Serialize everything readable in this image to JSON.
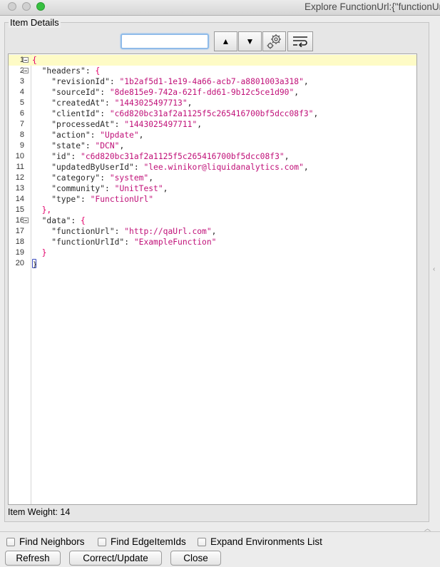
{
  "window": {
    "title": "Explore FunctionUrl:{\"functionUrl"
  },
  "panel": {
    "legend": "Item Details"
  },
  "search": {
    "value": "",
    "placeholder": ""
  },
  "toolbar": {
    "up_icon": "up-arrow-icon",
    "down_icon": "down-arrow-icon",
    "settings_icon": "gear-icon",
    "wrap_icon": "word-wrap-icon"
  },
  "editor": {
    "current_line": 1,
    "lines": [
      {
        "n": "1",
        "fold": true,
        "tokens": [
          {
            "t": "{",
            "c": "brace"
          }
        ]
      },
      {
        "n": "2",
        "fold": true,
        "tokens": [
          {
            "t": "  \"headers\"",
            "c": "key"
          },
          {
            "t": ": ",
            "c": "plain"
          },
          {
            "t": "{",
            "c": "brace"
          }
        ]
      },
      {
        "n": "3",
        "fold": false,
        "tokens": [
          {
            "t": "    \"revisionId\"",
            "c": "key"
          },
          {
            "t": ": ",
            "c": "plain"
          },
          {
            "t": "\"1b2af5d1-1e19-4a66-acb7-a8801003a318\"",
            "c": "str"
          },
          {
            "t": ",",
            "c": "plain"
          }
        ]
      },
      {
        "n": "4",
        "fold": false,
        "tokens": [
          {
            "t": "    \"sourceId\"",
            "c": "key"
          },
          {
            "t": ": ",
            "c": "plain"
          },
          {
            "t": "\"8de815e9-742a-621f-dd61-9b12c5ce1d90\"",
            "c": "str"
          },
          {
            "t": ",",
            "c": "plain"
          }
        ]
      },
      {
        "n": "5",
        "fold": false,
        "tokens": [
          {
            "t": "    \"createdAt\"",
            "c": "key"
          },
          {
            "t": ": ",
            "c": "plain"
          },
          {
            "t": "\"1443025497713\"",
            "c": "str"
          },
          {
            "t": ",",
            "c": "plain"
          }
        ]
      },
      {
        "n": "6",
        "fold": false,
        "tokens": [
          {
            "t": "    \"clientId\"",
            "c": "key"
          },
          {
            "t": ": ",
            "c": "plain"
          },
          {
            "t": "\"c6d820bc31af2a1125f5c265416700bf5dcc08f3\"",
            "c": "str"
          },
          {
            "t": ",",
            "c": "plain"
          }
        ]
      },
      {
        "n": "7",
        "fold": false,
        "tokens": [
          {
            "t": "    \"processedAt\"",
            "c": "key"
          },
          {
            "t": ": ",
            "c": "plain"
          },
          {
            "t": "\"1443025497711\"",
            "c": "str"
          },
          {
            "t": ",",
            "c": "plain"
          }
        ]
      },
      {
        "n": "8",
        "fold": false,
        "tokens": [
          {
            "t": "    \"action\"",
            "c": "key"
          },
          {
            "t": ": ",
            "c": "plain"
          },
          {
            "t": "\"Update\"",
            "c": "str"
          },
          {
            "t": ",",
            "c": "plain"
          }
        ]
      },
      {
        "n": "9",
        "fold": false,
        "tokens": [
          {
            "t": "    \"state\"",
            "c": "key"
          },
          {
            "t": ": ",
            "c": "plain"
          },
          {
            "t": "\"DCN\"",
            "c": "str"
          },
          {
            "t": ",",
            "c": "plain"
          }
        ]
      },
      {
        "n": "10",
        "fold": false,
        "tokens": [
          {
            "t": "    \"id\"",
            "c": "key"
          },
          {
            "t": ": ",
            "c": "plain"
          },
          {
            "t": "\"c6d820bc31af2a1125f5c265416700bf5dcc08f3\"",
            "c": "str"
          },
          {
            "t": ",",
            "c": "plain"
          }
        ]
      },
      {
        "n": "11",
        "fold": false,
        "tokens": [
          {
            "t": "    \"updatedByUserId\"",
            "c": "key"
          },
          {
            "t": ": ",
            "c": "plain"
          },
          {
            "t": "\"lee.winikor@liquidanalytics.com\"",
            "c": "str"
          },
          {
            "t": ",",
            "c": "plain"
          }
        ]
      },
      {
        "n": "12",
        "fold": false,
        "tokens": [
          {
            "t": "    \"category\"",
            "c": "key"
          },
          {
            "t": ": ",
            "c": "plain"
          },
          {
            "t": "\"system\"",
            "c": "str"
          },
          {
            "t": ",",
            "c": "plain"
          }
        ]
      },
      {
        "n": "13",
        "fold": false,
        "tokens": [
          {
            "t": "    \"community\"",
            "c": "key"
          },
          {
            "t": ": ",
            "c": "plain"
          },
          {
            "t": "\"UnitTest\"",
            "c": "str"
          },
          {
            "t": ",",
            "c": "plain"
          }
        ]
      },
      {
        "n": "14",
        "fold": false,
        "tokens": [
          {
            "t": "    \"type\"",
            "c": "key"
          },
          {
            "t": ": ",
            "c": "plain"
          },
          {
            "t": "\"FunctionUrl\"",
            "c": "str"
          }
        ]
      },
      {
        "n": "15",
        "fold": false,
        "tokens": [
          {
            "t": "  },",
            "c": "brace"
          }
        ]
      },
      {
        "n": "16",
        "fold": true,
        "tokens": [
          {
            "t": "  \"data\"",
            "c": "key"
          },
          {
            "t": ": ",
            "c": "plain"
          },
          {
            "t": "{",
            "c": "brace"
          }
        ]
      },
      {
        "n": "17",
        "fold": false,
        "tokens": [
          {
            "t": "    \"functionUrl\"",
            "c": "key"
          },
          {
            "t": ": ",
            "c": "plain"
          },
          {
            "t": "\"http://qaUrl.com\"",
            "c": "str"
          },
          {
            "t": ",",
            "c": "plain"
          }
        ]
      },
      {
        "n": "18",
        "fold": false,
        "tokens": [
          {
            "t": "    \"functionUrlId\"",
            "c": "key"
          },
          {
            "t": ": ",
            "c": "plain"
          },
          {
            "t": "\"ExampleFunction\"",
            "c": "str"
          }
        ]
      },
      {
        "n": "19",
        "fold": false,
        "tokens": [
          {
            "t": "  }",
            "c": "brace"
          }
        ]
      },
      {
        "n": "20",
        "fold": false,
        "tokens": [
          {
            "t": "}",
            "c": "caret"
          }
        ]
      }
    ]
  },
  "status": {
    "weight": "Item Weight: 14"
  },
  "options": {
    "find_neighbors": "Find Neighbors",
    "find_edge_item_ids": "Find EdgeItemIds",
    "expand_environments": "Expand Environments List"
  },
  "buttons": {
    "refresh": "Refresh",
    "correct_update": "Correct/Update",
    "close": "Close"
  },
  "colors": {
    "string": "#c01078",
    "brace": "#e3006a",
    "current_line": "#fefbc6"
  }
}
